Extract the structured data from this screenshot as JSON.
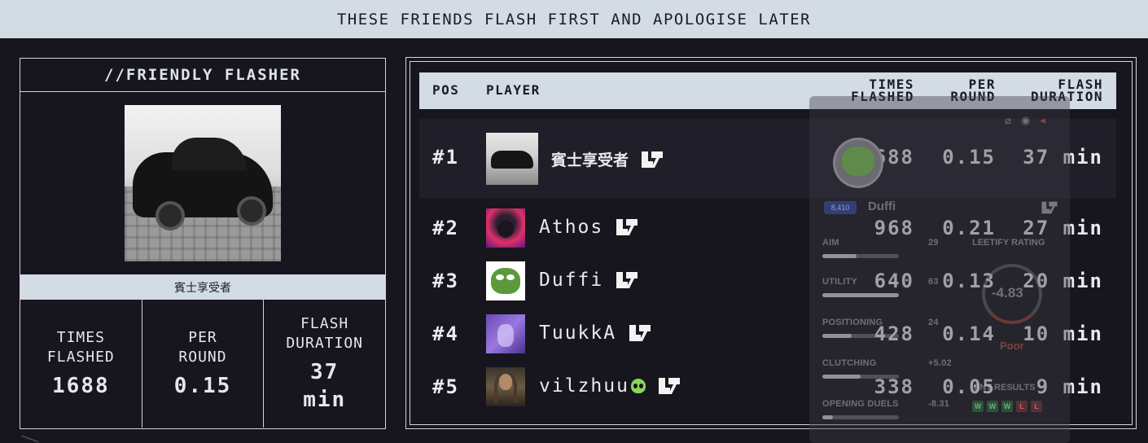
{
  "banner": {
    "text": "THESE FRIENDS FLASH FIRST AND APOLOGISE LATER"
  },
  "card": {
    "title": "//FRIENDLY FLASHER",
    "player_name": "賓士享受者",
    "stats": [
      {
        "label": "TIMES\nFLASHED",
        "value": "1688"
      },
      {
        "label": "PER\nROUND",
        "value": "0.15"
      },
      {
        "label": "FLASH\nDURATION",
        "value": "37\nmin"
      }
    ]
  },
  "board": {
    "headers": {
      "pos": "POS",
      "player": "PLAYER",
      "times": "TIMES\nFLASHED",
      "per": "PER\nROUND",
      "flash": "FLASH\nDURATION"
    },
    "rows": [
      {
        "pos": "#1",
        "name": "賓士享受者",
        "times": "1688",
        "per": "0.15",
        "duration": "37 min",
        "avatar": "black-car-avatar"
      },
      {
        "pos": "#2",
        "name": "Athos",
        "times": "968",
        "per": "0.21",
        "duration": "27 min",
        "avatar": "neon-bear-avatar"
      },
      {
        "pos": "#3",
        "name": "Duffi",
        "times": "640",
        "per": "0.13",
        "duration": "20 min",
        "avatar": "pepe-frog-avatar"
      },
      {
        "pos": "#4",
        "name": "TuukkA",
        "times": "428",
        "per": "0.14",
        "duration": "10 min",
        "avatar": "purple-figure-avatar"
      },
      {
        "pos": "#5",
        "name": "vilzhuu",
        "times": "338",
        "per": "0.05",
        "duration": "9 min",
        "avatar": "long-hair-man-avatar",
        "emoji": "alien-emoji"
      }
    ]
  },
  "overlay": {
    "name": "Duffi",
    "rank": "8,410",
    "stats": [
      {
        "label": "AIM",
        "value": "29",
        "fill": 0.45
      },
      {
        "label": "UTILITY",
        "value": "63",
        "fill": 1.0
      },
      {
        "label": "POSITIONING",
        "value": "24",
        "fill": 0.38
      },
      {
        "label": "CLUTCHING",
        "value": "+5.02",
        "fill": 0.5
      },
      {
        "label": "OPENING DUELS",
        "value": "-8.31",
        "fill": 0.14
      }
    ],
    "rating_label": "LEETIFY RATING",
    "rating_value": "-4.83",
    "rating_word": "Poor",
    "recent_label": "ENT RESULTS",
    "recent": [
      "W",
      "W",
      "W",
      "L",
      "L"
    ],
    "colors": {
      "win": "#3ca05a",
      "loss": "#b44646",
      "rank": "#3c5abe"
    }
  },
  "colors": {
    "background": "#17151d",
    "banner": "#d3dbe5",
    "row_highlight": "#201e28"
  }
}
